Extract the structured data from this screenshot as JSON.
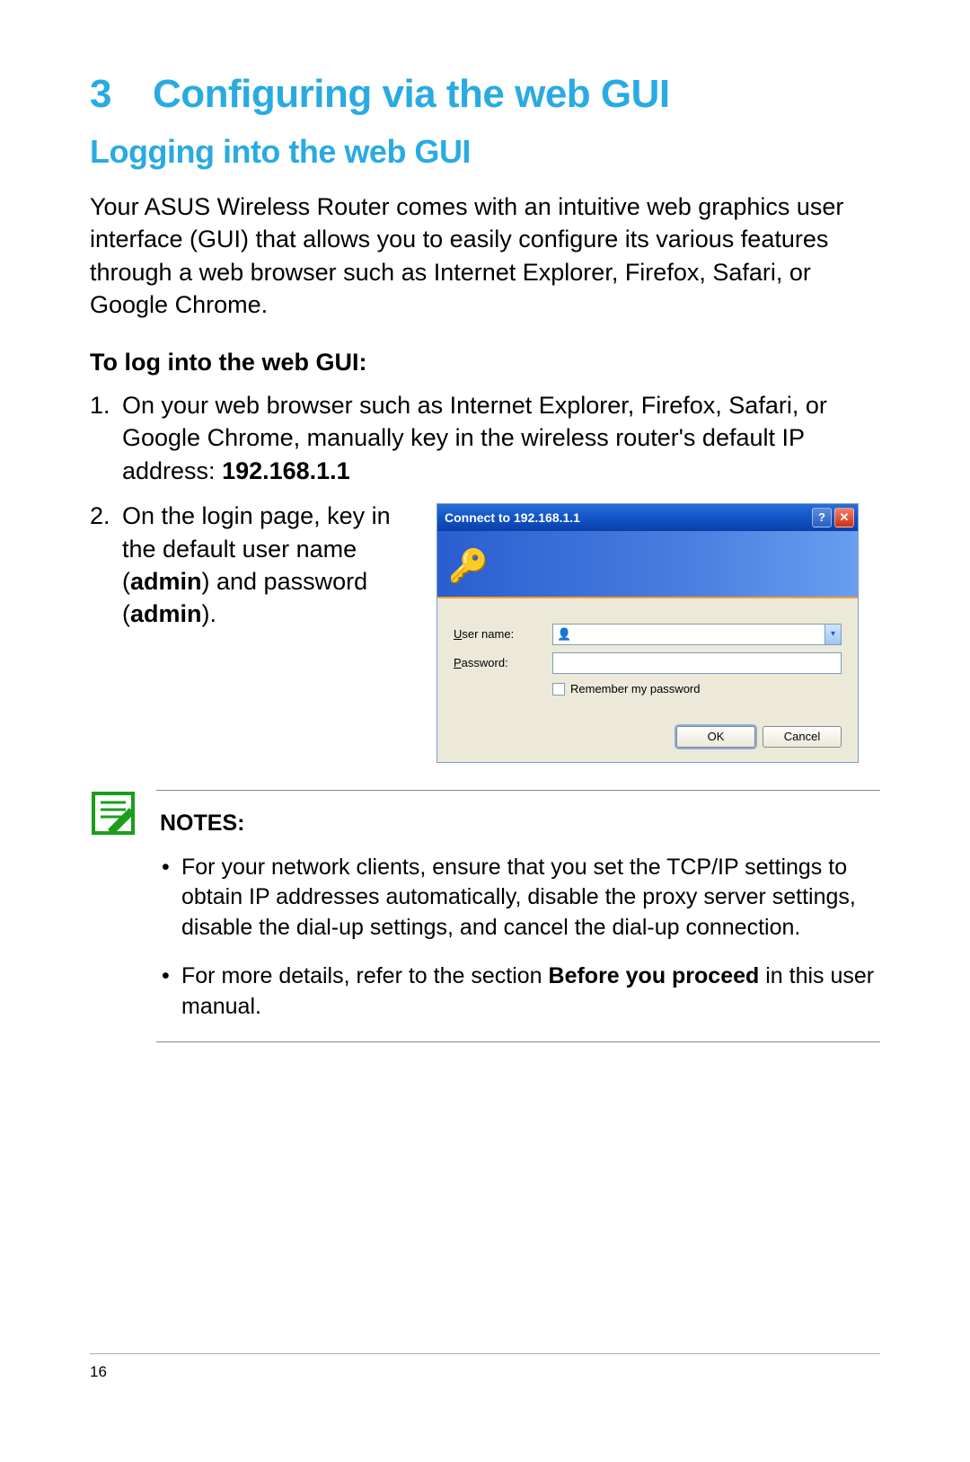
{
  "chapter": {
    "number": "3",
    "title": "Configuring via the web GUI"
  },
  "section": {
    "title": "Logging into the web GUI"
  },
  "intro": "Your ASUS Wireless Router comes with an intuitive web graphics user interface (GUI) that allows you to easily configure its various features through a web browser such as Internet Explorer, Firefox, Safari, or Google Chrome.",
  "sub_heading": "To log into the web GUI:",
  "steps": {
    "s1": {
      "num": "1.",
      "text_a": "On your web browser such as Internet Explorer, Firefox, Safari, or Google Chrome, manually key in the wireless router's default IP address: ",
      "ip": "192.168.1.1"
    },
    "s2": {
      "num": "2.",
      "text_a": "On the login page, key in the default user name (",
      "bold_a": "admin",
      "text_b": ") and password (",
      "bold_b": "admin",
      "text_c": ")."
    }
  },
  "dialog": {
    "title": "Connect to 192.168.1.1",
    "help": "?",
    "close": "✕",
    "user_prefix": "U",
    "user_rest": "ser name:",
    "pass_prefix": "P",
    "pass_rest": "assword:",
    "combo_icon": "👤",
    "dd": "▾",
    "remember_prefix": "R",
    "remember_rest": "emember my password",
    "ok": "OK",
    "cancel": "Cancel"
  },
  "notes": {
    "heading": "NOTES",
    "b1": "For your network clients, ensure that you set the TCP/IP settings to obtain IP addresses automatically, disable the proxy server settings, disable the dial-up settings, and cancel the dial-up connection.",
    "b2_a": "For more details, refer to the section ",
    "b2_bold": "Before you proceed",
    "b2_b": " in this user manual."
  },
  "page_number": "16"
}
